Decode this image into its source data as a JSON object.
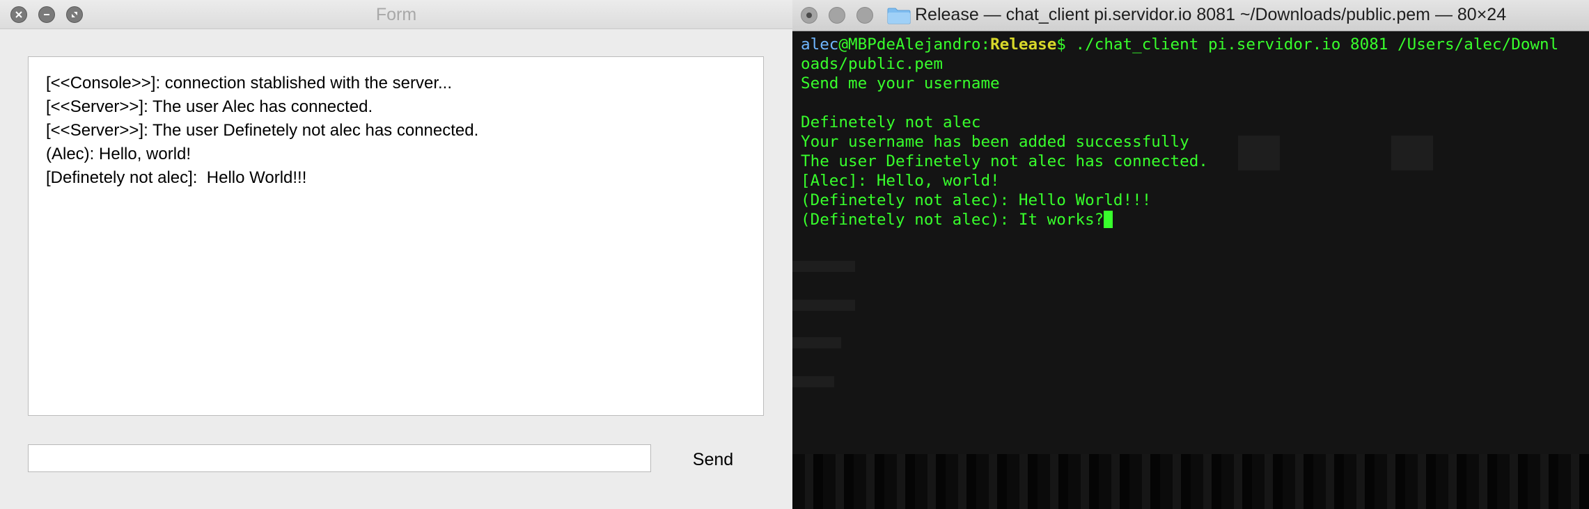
{
  "form_window": {
    "title": "Form",
    "chat_lines": [
      "[<<Console>>]: connection stablished with the server...",
      "[<<Server>>]: The user Alec has connected.",
      "[<<Server>>]: The user Definetely not alec has connected.",
      "(Alec): Hello, world!",
      "[Definetely not alec]:  Hello World!!!"
    ],
    "message_input": {
      "value": "",
      "placeholder": ""
    },
    "send_label": "Send"
  },
  "terminal_window": {
    "title": "Release — chat_client pi.servidor.io 8081 ~/Downloads/public.pem — 80×24",
    "prompt": {
      "user": "alec",
      "host": "@MBPdeAlejandro:",
      "dir": "Release",
      "symbol": "$",
      "command": " ./chat_client pi.servidor.io 8081 /Users/alec/Downl"
    },
    "lines": [
      "oads/public.pem",
      "Send me your username",
      "",
      "Definetely not alec",
      "Your username has been added successfully",
      "The user Definetely not alec has connected.",
      "[Alec]: Hello, world!",
      "(Definetely not alec): Hello World!!!",
      "(Definetely not alec): It works?"
    ]
  },
  "colors": {
    "terminal_text": "#38ff2c",
    "terminal_user": "#6fb6ff",
    "terminal_dir": "#d8d82a",
    "terminal_bg": "#141414"
  }
}
